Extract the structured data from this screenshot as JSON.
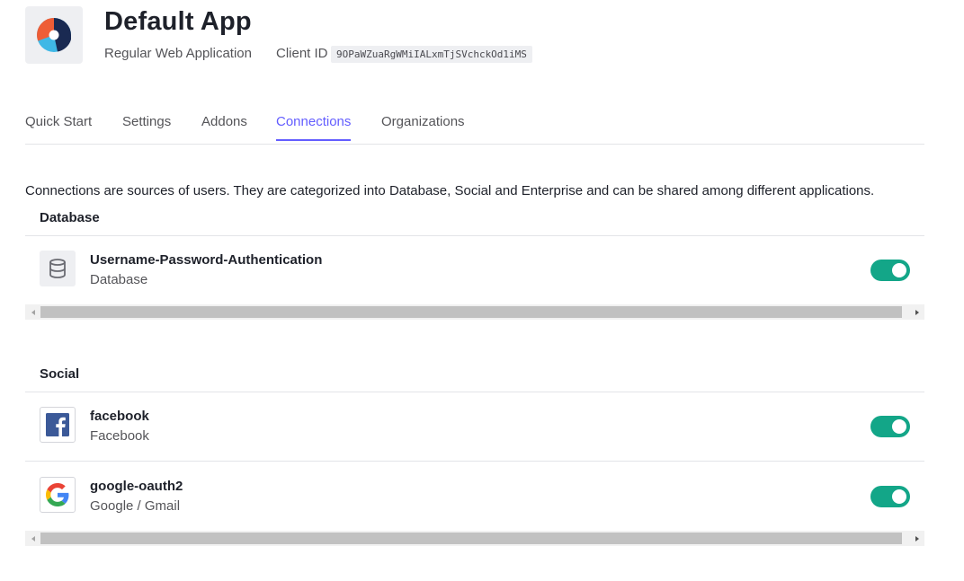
{
  "app": {
    "title": "Default App",
    "type": "Regular Web Application",
    "client_id_label": "Client ID",
    "client_id": "9OPaWZuaRgWMiIALxmTjSVchckOd1iMS",
    "logo_icon": "auth0-app-logo"
  },
  "tabs": [
    {
      "label": "Quick Start",
      "active": false
    },
    {
      "label": "Settings",
      "active": false
    },
    {
      "label": "Addons",
      "active": false
    },
    {
      "label": "Connections",
      "active": true
    },
    {
      "label": "Organizations",
      "active": false
    }
  ],
  "description": "Connections are sources of users. They are categorized into Database, Social and Enterprise and can be shared among different applications.",
  "sections": {
    "database": {
      "heading": "Database",
      "connections": [
        {
          "name": "Username-Password-Authentication",
          "type": "Database",
          "icon": "database-icon",
          "enabled": true
        }
      ]
    },
    "social": {
      "heading": "Social",
      "connections": [
        {
          "name": "facebook",
          "type": "Facebook",
          "icon": "facebook-icon",
          "enabled": true
        },
        {
          "name": "google-oauth2",
          "type": "Google / Gmail",
          "icon": "google-icon",
          "enabled": true
        }
      ]
    }
  },
  "colors": {
    "accent": "#635dff",
    "toggle_on": "#13a688",
    "text_primary": "#1e212a",
    "text_secondary": "#545458",
    "border": "#e3e4e8"
  }
}
